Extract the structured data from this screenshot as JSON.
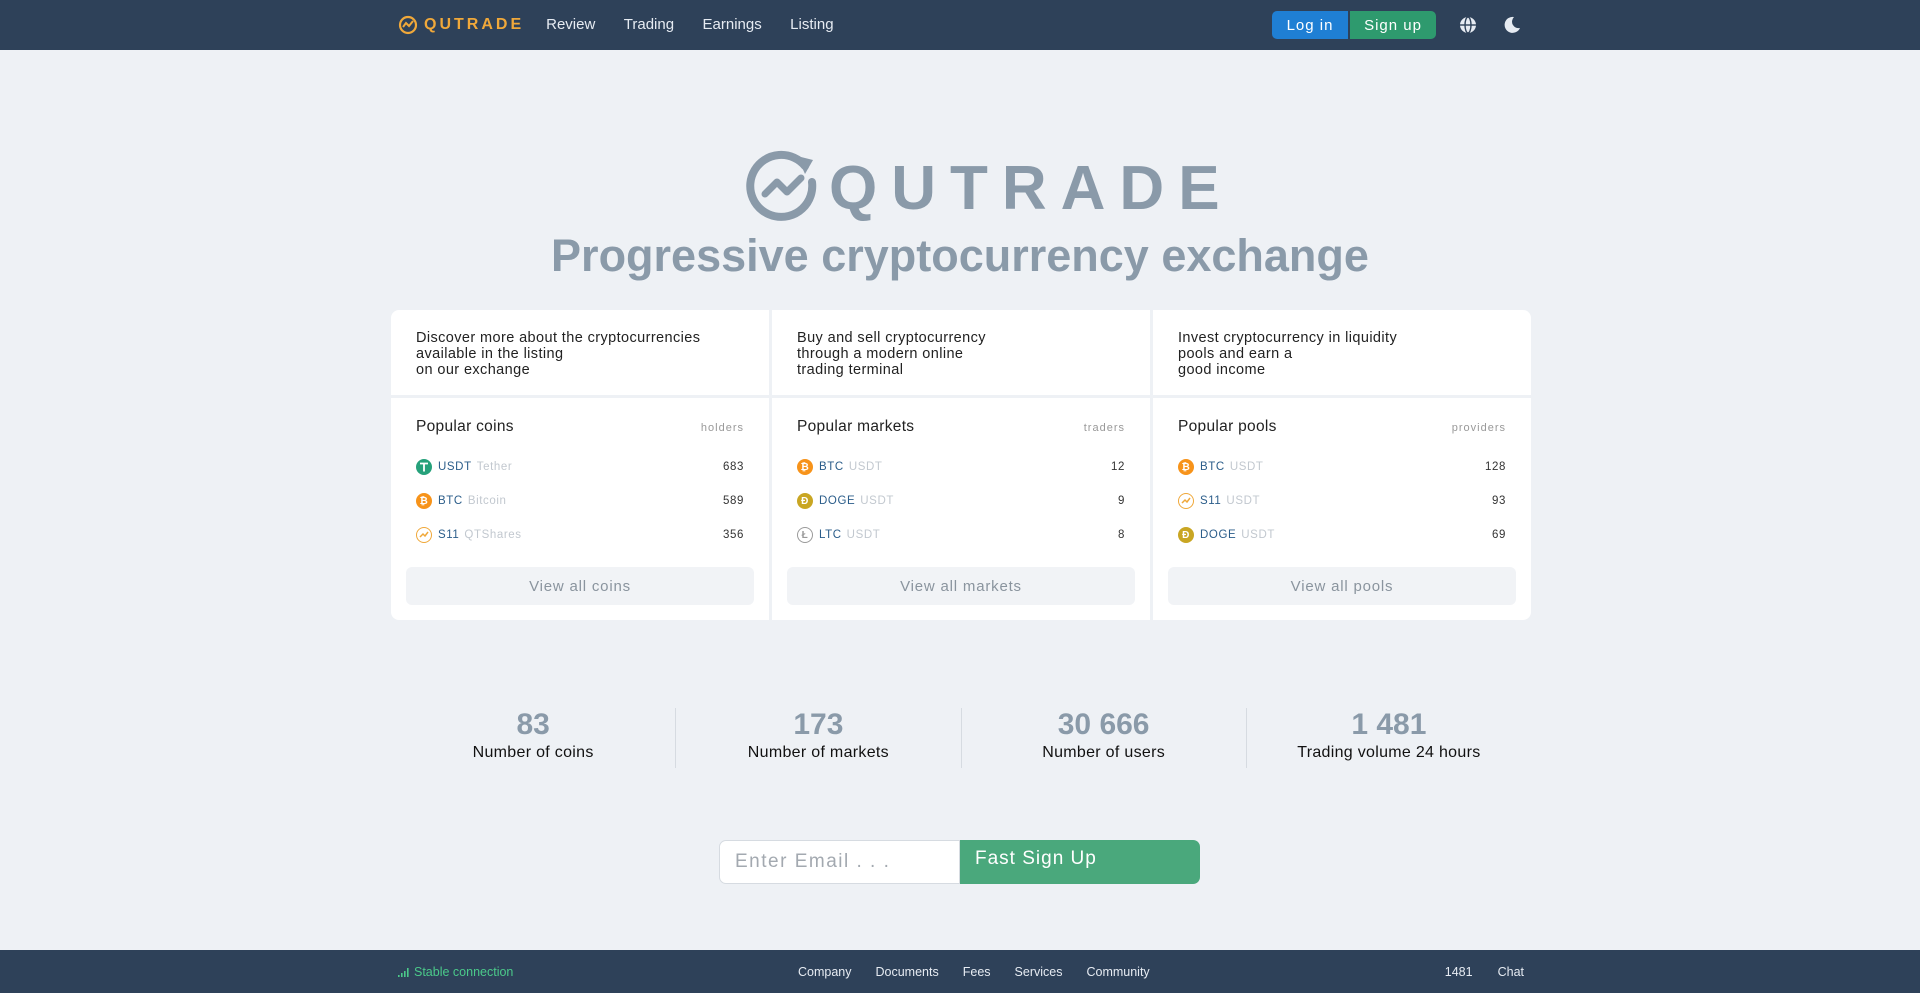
{
  "header": {
    "brand": "QUTRADE",
    "nav": [
      "Review",
      "Trading",
      "Earnings",
      "Listing"
    ],
    "login": "Log in",
    "signup": "Sign up",
    "icons": [
      "globe-icon",
      "moon-icon"
    ]
  },
  "hero": {
    "logo_text": "QUTRADE",
    "tagline": "Progressive cryptocurrency exchange"
  },
  "cards": [
    {
      "desc": "Discover more about the cryptocurrencies\navailable in the listing\non our exchange",
      "title": "Popular coins",
      "col": "holders",
      "rows": [
        {
          "sym": "USDT",
          "sub": "Tether",
          "val": "683",
          "icon": "tether",
          "color": "#26a17b"
        },
        {
          "sym": "BTC",
          "sub": "Bitcoin",
          "val": "589",
          "icon": "bitcoin",
          "color": "#f7931a"
        },
        {
          "sym": "S11",
          "sub": "QTShares",
          "val": "356",
          "icon": "s11",
          "color": "#f0a83a"
        }
      ],
      "button": "View all coins"
    },
    {
      "desc": "Buy and sell cryptocurrency\nthrough a modern online\ntrading terminal",
      "title": "Popular markets",
      "col": "traders",
      "rows": [
        {
          "sym": "BTC",
          "sub": "USDT",
          "val": "12",
          "icon": "bitcoin",
          "color": "#f7931a"
        },
        {
          "sym": "DOGE",
          "sub": "USDT",
          "val": "9",
          "icon": "doge",
          "color": "#c9a623"
        },
        {
          "sym": "LTC",
          "sub": "USDT",
          "val": "8",
          "icon": "litecoin",
          "color": "#9a9a9a"
        }
      ],
      "button": "View all markets"
    },
    {
      "desc": "Invest cryptocurrency in liquidity\npools and earn a\ngood income",
      "title": "Popular pools",
      "col": "providers",
      "rows": [
        {
          "sym": "BTC",
          "sub": "USDT",
          "val": "128",
          "icon": "bitcoin",
          "color": "#f7931a"
        },
        {
          "sym": "S11",
          "sub": "USDT",
          "val": "93",
          "icon": "s11",
          "color": "#f0a83a"
        },
        {
          "sym": "DOGE",
          "sub": "USDT",
          "val": "69",
          "icon": "doge",
          "color": "#c9a623"
        }
      ],
      "button": "View all pools"
    }
  ],
  "stats": [
    {
      "num": "83",
      "label": "Number of coins"
    },
    {
      "num": "173",
      "label": "Number of markets"
    },
    {
      "num": "30 666",
      "label": "Number of users"
    },
    {
      "num": "1 481",
      "label": "Trading volume 24 hours"
    }
  ],
  "signup": {
    "placeholder": "Enter Email . . .",
    "button": "Fast Sign Up"
  },
  "footer": {
    "connection": "Stable connection",
    "links": [
      "Company",
      "Documents",
      "Fees",
      "Services",
      "Community"
    ],
    "count": "1481",
    "chat": "Chat"
  },
  "colors": {
    "nav_bg": "#2e4159",
    "brand": "#f0a83a",
    "login": "#1f7fd4",
    "signup": "#2e9a6e",
    "fast_signup": "#4aa87c",
    "connection": "#4bc98a"
  }
}
